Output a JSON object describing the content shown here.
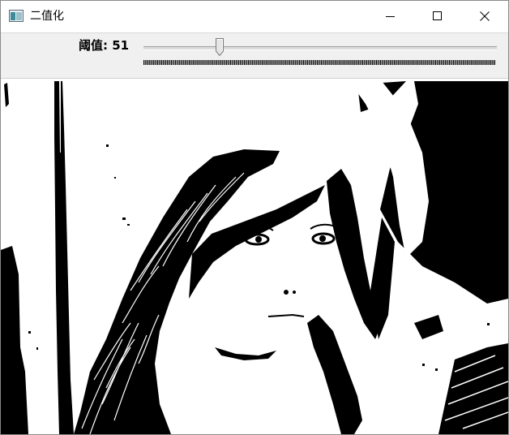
{
  "window": {
    "title": "二值化"
  },
  "controls": {
    "minimize_icon": "minimize-icon",
    "maximize_icon": "maximize-icon",
    "close_icon": "close-icon"
  },
  "trackbar": {
    "label": "阈值: 51",
    "value": 51,
    "max": 255
  },
  "image": {
    "description_icon": "binary-threshold-image"
  }
}
